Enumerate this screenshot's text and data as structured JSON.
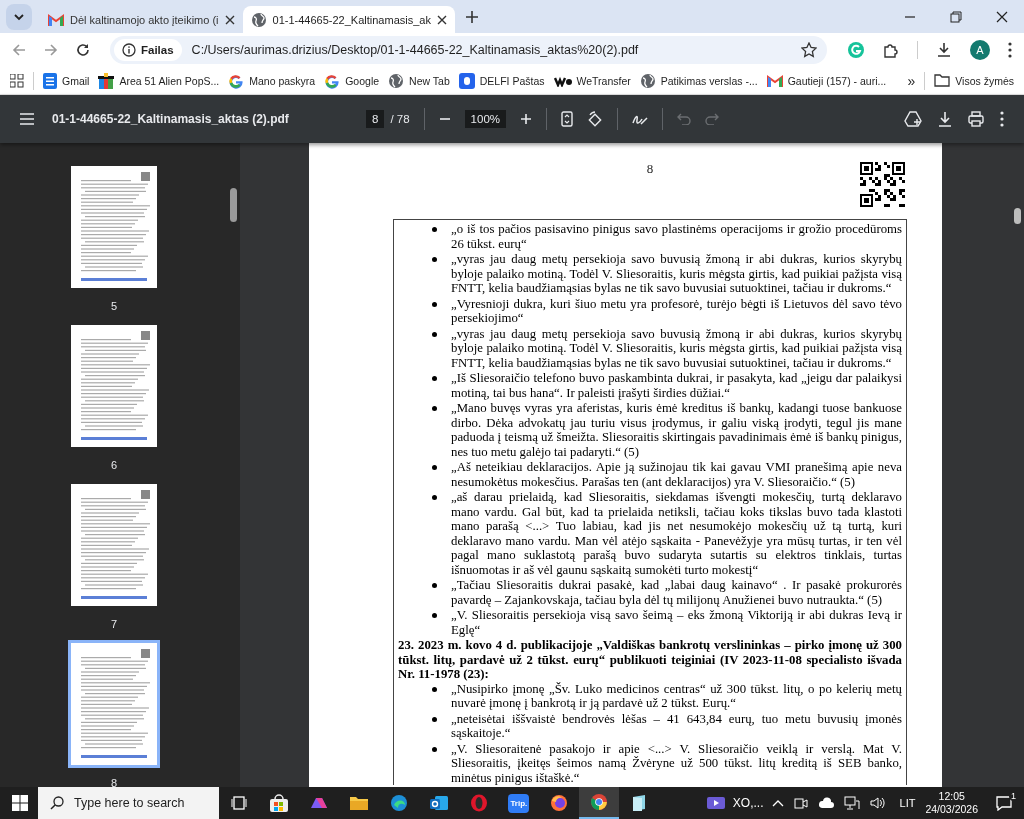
{
  "browser": {
    "tabs": [
      {
        "title": "Dėl kaltinamojo akto įteikimo (i",
        "kind": "gmail",
        "selected": false
      },
      {
        "title": "01-1-44665-22_Kaltinamasis_ak",
        "kind": "globe",
        "selected": true
      }
    ],
    "address": {
      "chip": "Failas",
      "url": "C:/Users/aurimas.drizius/Desktop/01-1-44665-22_Kaltinamasis_aktas%20(2).pdf"
    },
    "profile": "A",
    "bookmarks": [
      {
        "label": "Gmail",
        "kind": "doc"
      },
      {
        "label": "Area 51 Alien PopS...",
        "kind": "gift"
      },
      {
        "label": "Mano paskyra",
        "kind": "google"
      },
      {
        "label": "Google",
        "kind": "google"
      },
      {
        "label": "New Tab",
        "kind": "globe"
      },
      {
        "label": "DELFI Paštas",
        "kind": "delfi"
      },
      {
        "label": "WeTransfer",
        "kind": "we"
      },
      {
        "label": "Patikimas verslas -...",
        "kind": "globe"
      },
      {
        "label": "Gautieji (157) - auri...",
        "kind": "gmail"
      }
    ],
    "more_bookmarks": "»",
    "all_bookmarks": "Visos žymės"
  },
  "pdf_toolbar": {
    "title": "01-1-44665-22_Kaltinamasis_aktas (2).pdf",
    "page": "8",
    "page_total": "/ 78",
    "zoom": "100%",
    "tools": [
      {
        "kind": "undo",
        "disabled": true
      },
      {
        "kind": "redo",
        "disabled": true
      }
    ]
  },
  "thumbnails": [
    {
      "label": "5",
      "selected": false
    },
    {
      "label": "6",
      "selected": false
    },
    {
      "label": "7",
      "selected": false
    },
    {
      "label": "8",
      "selected": true
    }
  ],
  "page": {
    "number": "8",
    "items": [
      {
        "kind": "bullet",
        "text": "„o iš tos pačios pasisavino pinigus savo plastinėms operacijoms ir grožio procedūroms 26 tūkst. eurų“"
      },
      {
        "kind": "bullet",
        "text": "„vyras jau daug metų persekioja savo buvusią žmoną ir abi dukras, kurios skyrybų byloje palaiko motiną. Todėl V. Sliesoraitis, kuris mėgsta girtis, kad puikiai pažįsta visą FNTT, kelia baudžiamąsias bylas ne tik savo buvusiai sutuoktinei, tačiau ir dukroms.“"
      },
      {
        "kind": "bullet",
        "text": "„Vyresnioji dukra, kuri šiuo metu yra profesorė, turėjo bėgti iš Lietuvos dėl savo tėvo persekiojimo“"
      },
      {
        "kind": "bullet",
        "text": "„vyras jau daug metų persekioja savo buvusią žmoną ir abi dukras, kurios skyrybų byloje palaiko motiną. Todėl V. Sliesoraitis, kuris mėgsta girtis, kad puikiai pažįsta visą FNTT, kelia baudžiamąsias bylas ne tik savo buvusiai sutuoktinei, tačiau ir dukroms.“"
      },
      {
        "kind": "bullet",
        "text": "„Iš Sliesoraičio telefono buvo paskambinta dukrai, ir pasakyta, kad „jeigu dar palaikysi motiną, tai bus hana“. Ir paleisti įrašyti širdies dūžiai.“"
      },
      {
        "kind": "bullet",
        "text": "„Mano buvęs vyras yra aferistas, kuris ėmė kreditus iš bankų, kadangi tuose bankuose dirbo. Dėka advokatų jau turiu visus įrodymus, ir galiu viską įrodyti, tegul jis mane paduoda į teismą už šmeižta. Sliesoraitis skirtingais pavadinimais ėmė iš bankų pinigus, nes tuo metu galėjo tai padaryti.“ (5)"
      },
      {
        "kind": "bullet",
        "text": "„Aš neteikiau deklaracijos. Apie ją sužinojau tik kai gavau VMI pranešimą apie neva nesumokėtus mokesčius. Parašas ten (ant deklaracijos) yra V. Sliesoraičio.“ (5)"
      },
      {
        "kind": "bullet",
        "text": "„aš darau prielaidą, kad Sliesoraitis, siekdamas išvengti mokesčių, turtą deklaravo mano vardu. Gal būt, kad ta prielaida netiksli, tačiau koks tikslas buvo tada klastoti mano parašą <...> Tuo labiau, kad jis net nesumokėjo mokesčių už tą turtą, kuri deklaravo mano vardu. Man vėl atėjo sąskaita - Panevėžyje yra mūsų turtas, ir ten vėl pagal mano suklastotą parašą buvo sudaryta sutartis su elektros tinklais, turtas išnuomotas ir aš vėl gaunu sąskaitą sumokėti turto mokestį“"
      },
      {
        "kind": "bullet",
        "text": "„Tačiau Sliesoraitis dukrai pasakė, kad „labai daug kainavo“ . Ir pasakė prokurorės pavardę – Zajankovskaja, tačiau byla dėl tų milijonų Anužienei buvo nutraukta.“ (5)"
      },
      {
        "kind": "bullet",
        "text": "„V. Sliesoraitis persekioja visą savo šeimą – eks žmoną Viktoriją ir abi dukras Ievą ir Eglę“"
      },
      {
        "kind": "heading",
        "text": "23. 2023 m. kovo 4 d. publikacijoje „Valdiškas bankrotų verslininkas – pirko įmonę už 300 tūkst. litų, pardavė už 2 tūkst. eurų“ publikuoti teiginiai (IV 2023-11-08 specialisto išvada Nr. 11-1978 (23):"
      },
      {
        "kind": "bullet",
        "text": "„Nusipirko įmonę „Šv. Luko medicinos centras“ už 300 tūkst. litų, o po kelerių metų nuvarė įmonę į bankrotą ir ją pardavė už 2 tūkst. Eurų.“"
      },
      {
        "kind": "bullet",
        "text": "„neteisėtai iššvaistė bendrovės lėšas – 41 643,84 eurų, tuo metu buvusių įmonės sąskaitoje.“"
      },
      {
        "kind": "bullet",
        "text": "„V. Sliesoraitenė pasakojo ir apie <...> V. Sliesoraičio veiklą ir verslą. Mat V. Sliesoraitis, įkeitęs šeimos namą Žvėryne už 500 tūkst. litų kreditą iš SEB banko, minėtus pinigus ištaškė.“"
      }
    ]
  },
  "taskbar": {
    "search_placeholder": "Type here to search",
    "apps": [
      {
        "kind": "taskview",
        "selected": false
      },
      {
        "kind": "store",
        "selected": false
      },
      {
        "kind": "m365",
        "selected": false
      },
      {
        "kind": "folder",
        "selected": false
      },
      {
        "kind": "edge",
        "selected": false
      },
      {
        "kind": "outlook",
        "selected": false
      },
      {
        "kind": "opera",
        "selected": false
      },
      {
        "kind": "trip",
        "label": "Trip.",
        "selected": false
      },
      {
        "kind": "firefox",
        "selected": false
      },
      {
        "kind": "chrome",
        "selected": true
      },
      {
        "kind": "notes",
        "selected": false
      }
    ],
    "window_button": "XO,...",
    "language": "LIT",
    "time": "12:05",
    "date": "24/03/2026",
    "notifications": "1"
  }
}
